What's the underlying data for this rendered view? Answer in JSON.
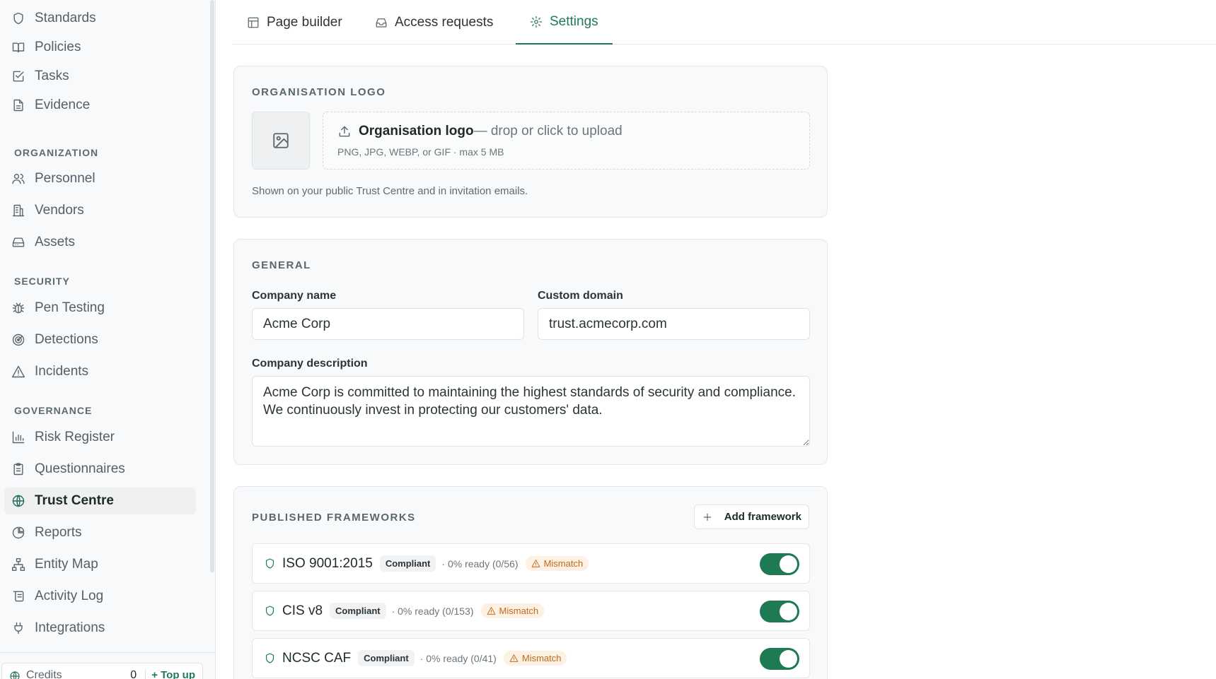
{
  "sidebar": {
    "items_top": [
      {
        "label": "Standards",
        "icon": "shield-icon"
      },
      {
        "label": "Policies",
        "icon": "book-icon"
      },
      {
        "label": "Tasks",
        "icon": "checkbox-icon"
      },
      {
        "label": "Evidence",
        "icon": "file-icon"
      }
    ],
    "section_org": "ORGANIZATION",
    "items_org": [
      {
        "label": "Personnel",
        "icon": "users-icon"
      },
      {
        "label": "Vendors",
        "icon": "building-icon"
      },
      {
        "label": "Assets",
        "icon": "hard-drive-icon"
      }
    ],
    "section_security": "SECURITY",
    "items_security": [
      {
        "label": "Pen Testing",
        "icon": "bug-icon"
      },
      {
        "label": "Detections",
        "icon": "radar-icon"
      },
      {
        "label": "Incidents",
        "icon": "alert-triangle-icon"
      }
    ],
    "section_governance": "GOVERNANCE",
    "items_governance": [
      {
        "label": "Risk Register",
        "icon": "bar-chart-icon"
      },
      {
        "label": "Questionnaires",
        "icon": "clipboard-icon"
      },
      {
        "label": "Trust Centre",
        "icon": "globe-icon",
        "active": true
      },
      {
        "label": "Reports",
        "icon": "pie-chart-icon"
      },
      {
        "label": "Entity Map",
        "icon": "network-icon"
      },
      {
        "label": "Activity Log",
        "icon": "scroll-icon"
      },
      {
        "label": "Integrations",
        "icon": "plug-icon"
      }
    ],
    "credits_label": "Credits",
    "credits_count": "0",
    "topup_label": "+ Top up"
  },
  "tabs": [
    {
      "label": "Page builder",
      "icon": "layout-icon"
    },
    {
      "label": "Access requests",
      "icon": "inbox-icon"
    },
    {
      "label": "Settings",
      "icon": "gear-icon",
      "active": true
    }
  ],
  "logo_card": {
    "title": "ORGANISATION LOGO",
    "upload_strong": "Organisation logo",
    "upload_rest": " — drop or click to upload",
    "upload_hint": "PNG, JPG, WEBP, or GIF · max 5 MB",
    "helper": "Shown on your public Trust Centre and in invitation emails."
  },
  "general_card": {
    "title": "GENERAL",
    "company_name_label": "Company name",
    "company_name_value": "Acme Corp",
    "custom_domain_label": "Custom domain",
    "custom_domain_value": "trust.acmecorp.com",
    "description_label": "Company description",
    "description_value": "Acme Corp is committed to maintaining the highest standards of security and compliance. We continuously invest in protecting our customers' data."
  },
  "frameworks_card": {
    "title": "PUBLISHED FRAMEWORKS",
    "add_label": "Add framework",
    "rows": [
      {
        "name": "ISO 9001:2015",
        "status": "Compliant",
        "ready": "· 0% ready (0/56)",
        "warning": "Mismatch",
        "enabled": true
      },
      {
        "name": "CIS v8",
        "status": "Compliant",
        "ready": "· 0% ready (0/153)",
        "warning": "Mismatch",
        "enabled": true
      },
      {
        "name": "NCSC CAF",
        "status": "Compliant",
        "ready": "· 0% ready (0/41)",
        "warning": "Mismatch",
        "enabled": true
      }
    ]
  },
  "colors": {
    "accent": "#1f7a5c",
    "toggle_on": "#1d7a52",
    "warning": "#c26a1d"
  }
}
